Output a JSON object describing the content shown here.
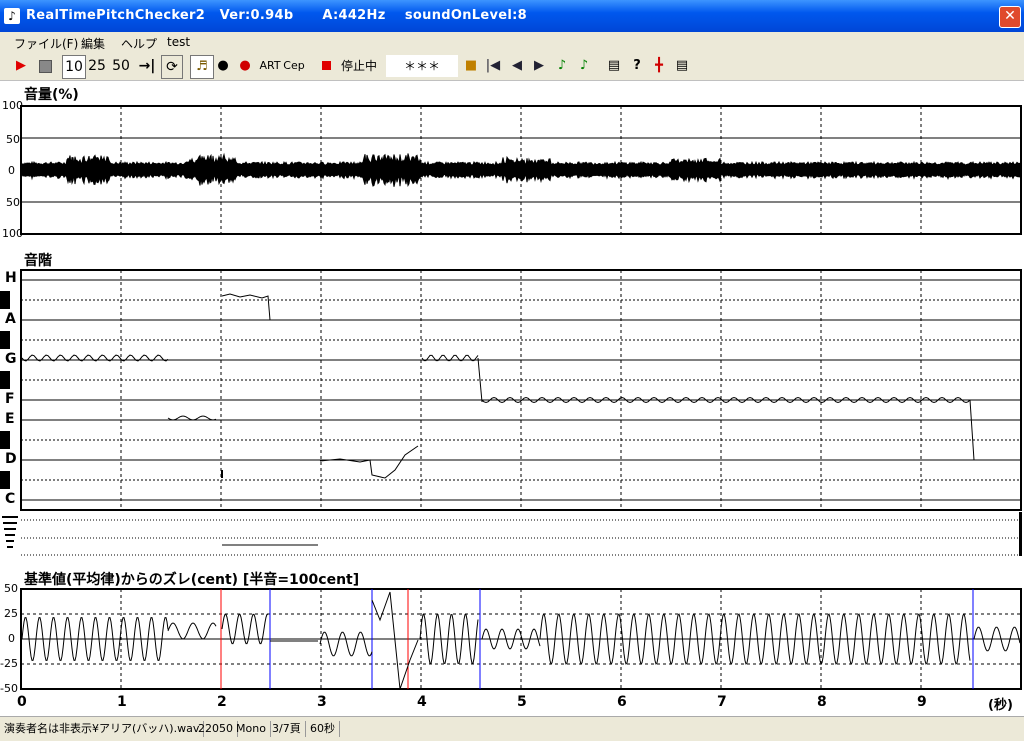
{
  "window": {
    "title": "RealTimePitchChecker2   Ver:0.94b      A:442Hz    soundOnLevel:8",
    "close_glyph": "✕"
  },
  "menu": [
    "ファイル(F)",
    "編集",
    "ヘルプ",
    "test"
  ],
  "toolbar": {
    "play_icon": "play-icon",
    "stop_icon": "stop-icon",
    "speed_options": [
      "10",
      "25",
      "50"
    ],
    "art_label": "ART",
    "cep_label": "Cep",
    "status_label": "停止中",
    "note_display": "＊＊＊"
  },
  "volume_panel": {
    "title": "音量(%)",
    "y_ticks": [
      "100",
      "50",
      "0",
      "50",
      "100"
    ]
  },
  "scale_panel": {
    "title": "音階",
    "notes": [
      "H",
      "A",
      "G",
      "F",
      "E",
      "D",
      "C"
    ]
  },
  "deviation_panel": {
    "title": "基準値(平均律)からのズレ(cent) [半音=100cent]",
    "y_ticks": [
      "50",
      "25",
      "0",
      "-25",
      "-50"
    ]
  },
  "time_axis": {
    "ticks": [
      "0",
      "1",
      "2",
      "3",
      "4",
      "5",
      "6",
      "7",
      "8",
      "9"
    ],
    "unit": "(秒)"
  },
  "statusbar": {
    "file": "演奏者名は非表示¥アリア(バッハ).wav",
    "rate": "22050",
    "channels": "Mono",
    "page": "3/7頁",
    "duration": "60秒"
  },
  "colors": {
    "title_bar": "#0054e3",
    "trace": "#000000",
    "grid": "#000000",
    "marker_red": "#ff0000",
    "marker_blue": "#0000ff"
  }
}
